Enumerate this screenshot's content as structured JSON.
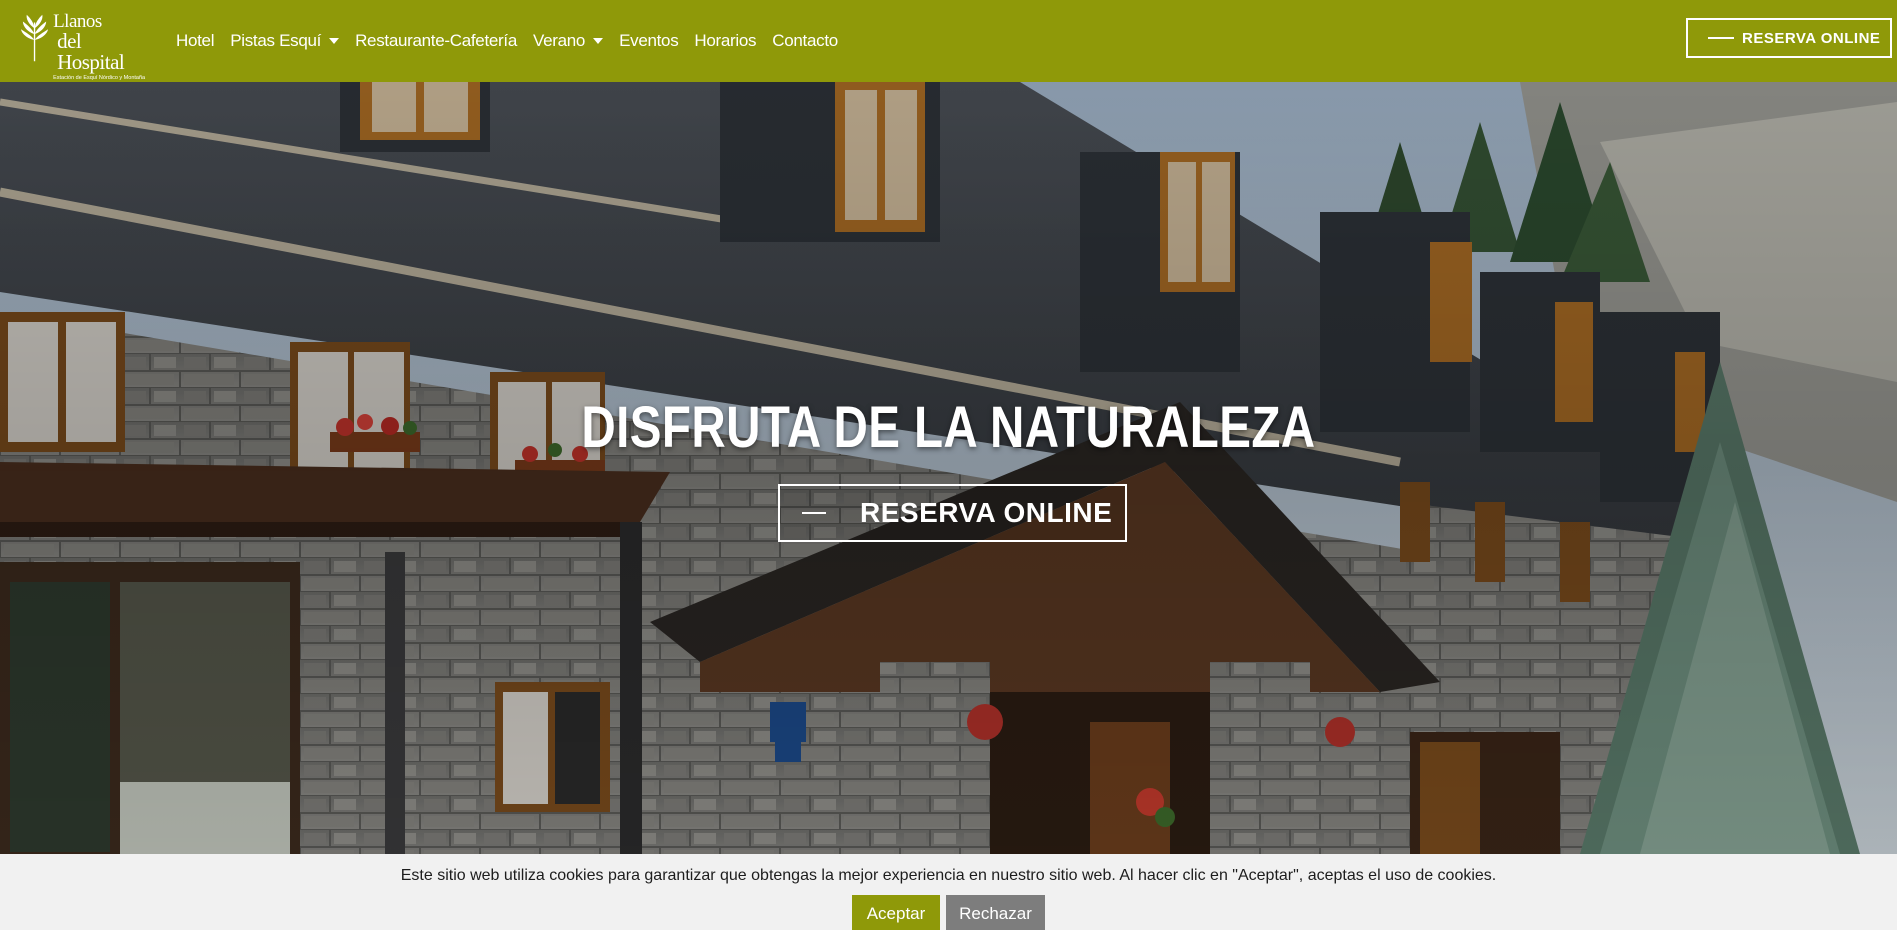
{
  "brand": {
    "name_line1": "Llanos",
    "name_line2": "del Hospital",
    "tagline": "Estación de Esquí Nórdico y Montaña"
  },
  "nav": {
    "items": [
      {
        "label": "Hotel"
      },
      {
        "label": "Pistas Esquí",
        "dropdown": true
      },
      {
        "label": "Restaurante-Cafetería"
      },
      {
        "label": "Verano",
        "dropdown": true
      },
      {
        "label": "Eventos"
      },
      {
        "label": "Horarios"
      },
      {
        "label": "Contacto"
      }
    ],
    "cta_label": "RESERVA ONLINE"
  },
  "hero": {
    "title": "DISFRUTA DE LA NATURALEZA",
    "cta_label": "RESERVA ONLINE"
  },
  "cookie": {
    "message": "Este sitio web utiliza cookies para garantizar que obtengas la mejor experiencia en nuestro sitio web. Al hacer clic en \"Aceptar\", aceptas el uso de cookies.",
    "accept_label": "Aceptar",
    "reject_label": "Rechazar"
  },
  "colors": {
    "brand_olive": "#8f9909",
    "reject_gray": "#7d7d7d",
    "cookie_bg": "#f1f1f1"
  }
}
